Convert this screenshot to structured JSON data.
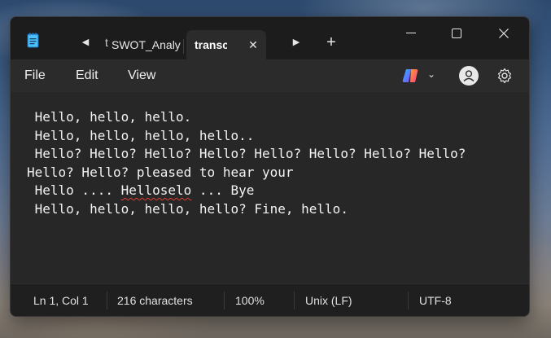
{
  "window": {
    "tabs": [
      {
        "label": "t"
      },
      {
        "label": "SWOT_Analy"
      },
      {
        "label": "transc",
        "active": true
      }
    ],
    "controls": {
      "minimize": "—",
      "maximize": "☐",
      "close": "✕"
    }
  },
  "menu": {
    "file": "File",
    "edit": "Edit",
    "view": "View"
  },
  "icons": {
    "app": "notepad-icon",
    "prev": "tab-prev-icon",
    "next": "tab-next-icon",
    "new_tab": "plus-icon",
    "copilot": "copilot-icon",
    "avatar": "avatar-icon",
    "settings": "gear-icon"
  },
  "editor": {
    "lines": [
      " Hello, hello, hello.",
      " Hello, hello, hello, hello..",
      " Hello? Hello? Hello? Hello? Hello? Hello? Hello? Hello?",
      "Hello? Hello? pleased to hear your",
      " Hello .... ",
      "Helloselo",
      " ... Bye",
      " Hello, hello, hello, hello? Fine, hello."
    ],
    "misspelled_word": "Helloselo"
  },
  "status": {
    "position": "Ln 1, Col 1",
    "characters": "216 characters",
    "zoom": "100%",
    "line_endings": "Unix (LF)",
    "encoding": "UTF-8"
  },
  "colors": {
    "window_bg": "#202020",
    "editor_bg": "#272727",
    "text": "#f2f2f2",
    "spellcheck_underline": "#e03c31"
  }
}
